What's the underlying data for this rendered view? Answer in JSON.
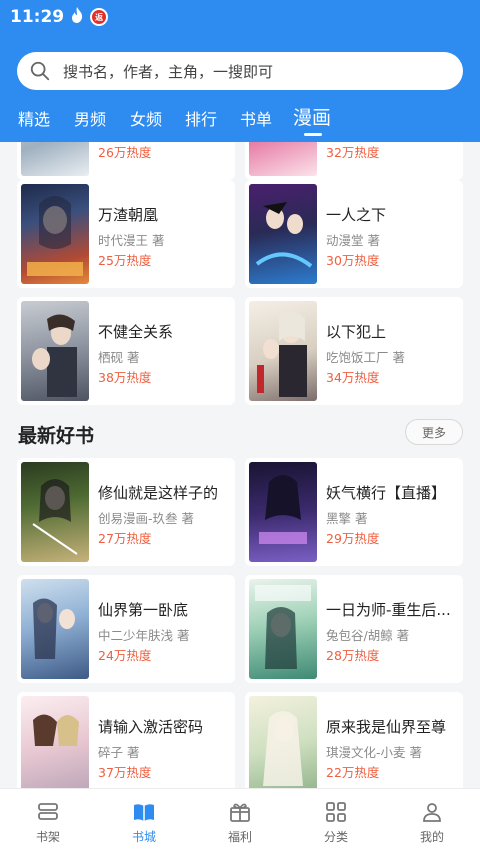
{
  "status_bar": {
    "time": "11:29",
    "flame_icon": "fire-icon",
    "notification_badge": "返"
  },
  "search": {
    "placeholder": "搜书名，作者，主角，一搜即可",
    "icon": "search-icon"
  },
  "tabs": [
    {
      "label": "精选"
    },
    {
      "label": "男频"
    },
    {
      "label": "女频"
    },
    {
      "label": "排行"
    },
    {
      "label": "书单"
    },
    {
      "label": "漫画",
      "active": true
    }
  ],
  "partial_row": [
    {
      "heat": "26万热度"
    },
    {
      "heat": "32万热度"
    }
  ],
  "top_books": [
    {
      "title": "万渣朝凰",
      "author": "时代漫王 著",
      "heat": "25万热度"
    },
    {
      "title": "一人之下",
      "author": "动漫堂 著",
      "heat": "30万热度"
    },
    {
      "title": "不健全关系",
      "author": "栖砚 著",
      "heat": "38万热度"
    },
    {
      "title": "以下犯上",
      "author": "吃饱饭工厂 著",
      "heat": "34万热度"
    }
  ],
  "new_section": {
    "title": "最新好书",
    "more_label": "更多",
    "books": [
      {
        "title": "修仙就是这样子的",
        "author": "创易漫画-玖叁 著",
        "heat": "27万热度"
      },
      {
        "title": "妖气横行【直播】",
        "author": "黑擎 著",
        "heat": "29万热度"
      },
      {
        "title": "仙界第一卧底",
        "author": "中二少年肤浅 著",
        "heat": "24万热度"
      },
      {
        "title": "一日为师-重生后...",
        "author": "兔包谷/胡鲸 著",
        "heat": "28万热度"
      },
      {
        "title": "请输入激活密码",
        "author": "碎子 著",
        "heat": "37万热度"
      },
      {
        "title": "原来我是仙界至尊",
        "author": "琪漫文化-小麦 著",
        "heat": "22万热度"
      }
    ]
  },
  "bottom_nav": [
    {
      "label": "书架",
      "icon": "bookshelf-icon"
    },
    {
      "label": "书城",
      "icon": "book-city-icon",
      "active": true
    },
    {
      "label": "福利",
      "icon": "gift-icon"
    },
    {
      "label": "分类",
      "icon": "category-grid-icon"
    },
    {
      "label": "我的",
      "icon": "user-icon"
    }
  ],
  "colors": {
    "brand_blue": "#2e8bf0",
    "heat_red": "#ef5f41",
    "background": "#f4f5f7"
  }
}
